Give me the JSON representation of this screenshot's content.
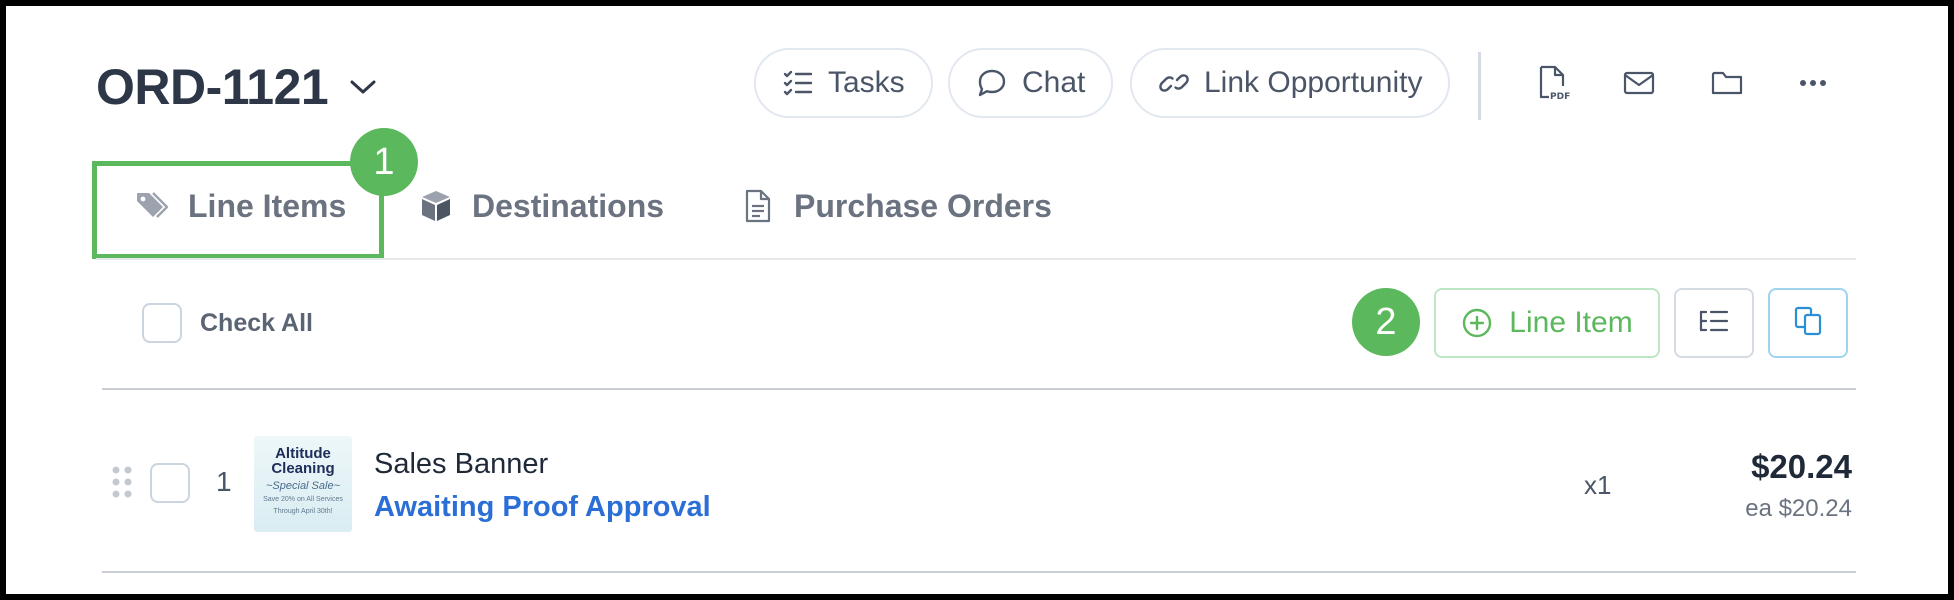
{
  "header": {
    "order_id": "ORD-1121"
  },
  "actions": {
    "tasks_label": "Tasks",
    "chat_label": "Chat",
    "link_label": "Link Opportunity"
  },
  "tabs": [
    {
      "label": "Line Items",
      "icon": "tags-icon"
    },
    {
      "label": "Destinations",
      "icon": "box-icon"
    },
    {
      "label": "Purchase Orders",
      "icon": "document-icon"
    }
  ],
  "callouts": {
    "step1": "1",
    "step2": "2",
    "color": "#5cb85c"
  },
  "toolbar": {
    "check_all_label": "Check All",
    "add_line_label": "Line Item"
  },
  "line_items": [
    {
      "index": "1",
      "name": "Sales Banner",
      "status": "Awaiting Proof Approval",
      "quantity": "x1",
      "price": "$20.24",
      "unit_price": "ea $20.24",
      "thumbnail": {
        "line1": "Altitude",
        "line2": "Cleaning",
        "line3": "~Special Sale~",
        "line4": "Save 20% on All Services",
        "line5": "Through April 30th!"
      }
    }
  ],
  "colors": {
    "accent_green": "#5cb85c",
    "status_blue": "#2b6fd6",
    "title": "#2d3748"
  }
}
